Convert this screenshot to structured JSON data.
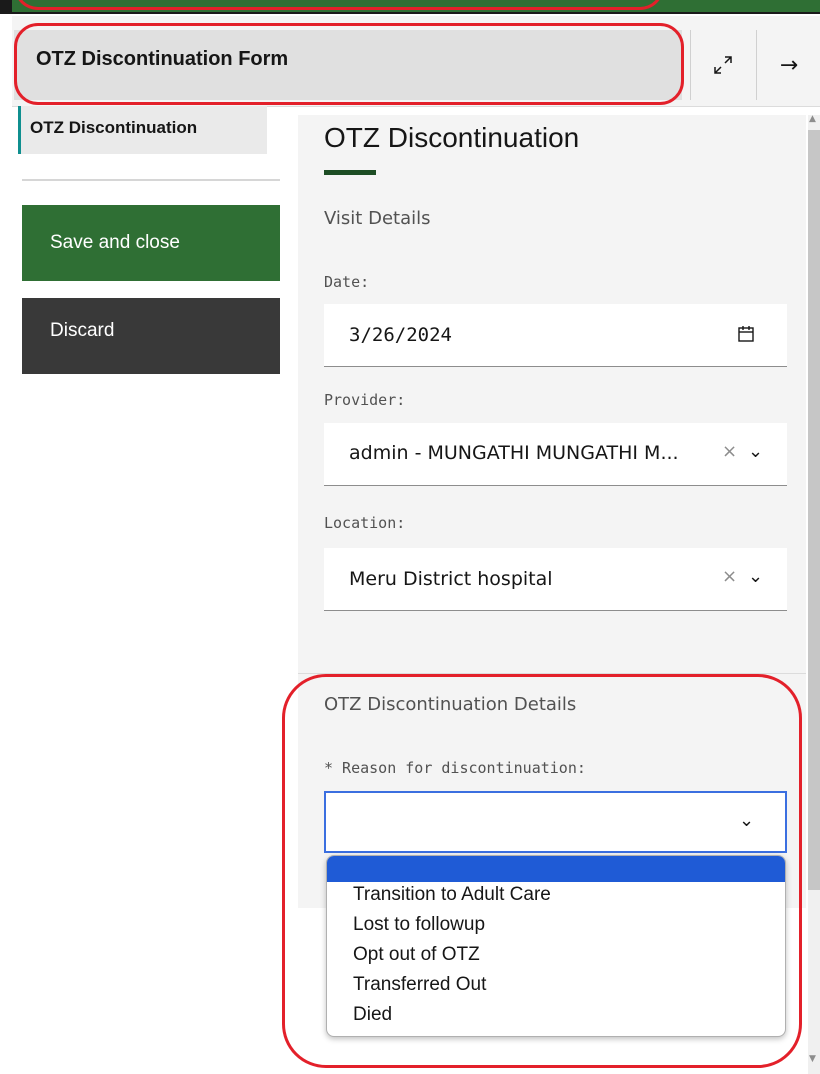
{
  "header": {
    "title": "OTZ Discontinuation Form",
    "maximize_icon": "maximize-icon",
    "forward_icon": "arrow-right-icon",
    "forward_glyph": "→"
  },
  "sidebar": {
    "tab_label": "OTZ Discontinuation",
    "save_label": "Save and close",
    "discard_label": "Discard"
  },
  "form": {
    "title": "OTZ Discontinuation",
    "visit_section": "Visit Details",
    "date": {
      "label": "Date:",
      "value": "3/26/2024",
      "icon": "calendar-icon"
    },
    "provider": {
      "label": "Provider:",
      "value": "admin - MUNGATHI MUNGATHI M...",
      "clear_glyph": "×",
      "chevron_glyph": "⌄"
    },
    "location": {
      "label": "Location:",
      "value": "Meru District hospital",
      "clear_glyph": "×",
      "chevron_glyph": "⌄"
    },
    "otz_section": "OTZ Discontinuation Details",
    "reason": {
      "label": "* Reason for discontinuation:",
      "value": "",
      "chevron_glyph": "⌄",
      "options": [
        "Transition to Adult Care",
        "Lost to followup",
        "Opt out of OTZ",
        "Transferred Out",
        "Died"
      ]
    }
  },
  "colors": {
    "brand_green": "#2f6f34",
    "discard_gray": "#393939",
    "focus_blue": "#3b6fe0",
    "option_highlight": "#1f5bd6",
    "annotation_red": "#e3202a"
  }
}
